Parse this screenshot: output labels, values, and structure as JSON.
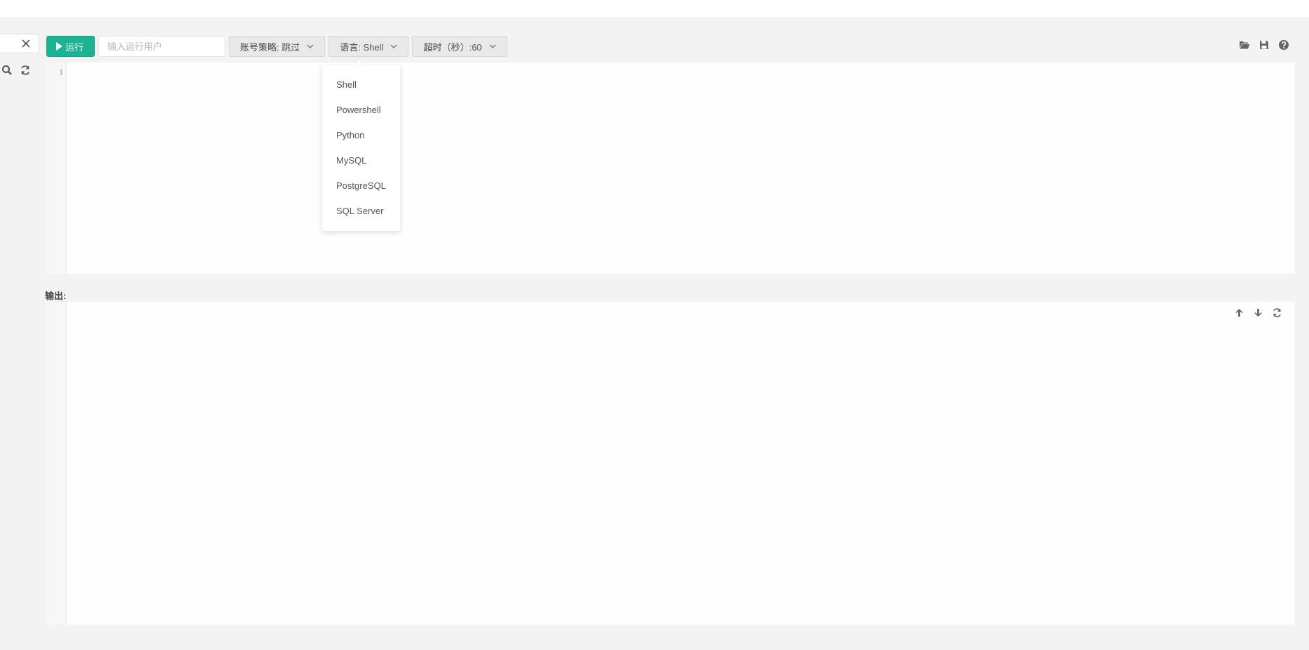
{
  "toolbar": {
    "run_label": "运行",
    "user_placeholder": "输入运行用户",
    "account_policy": {
      "key": "账号策略:",
      "value": "跳过"
    },
    "language": {
      "key": "语言:",
      "value": "Shell"
    },
    "timeout": {
      "key": "超时（秒）:",
      "value": "60"
    }
  },
  "editor": {
    "line_numbers": [
      "1"
    ]
  },
  "output": {
    "label": "输出:"
  },
  "language_menu": {
    "items": [
      "Shell",
      "Powershell",
      "Python",
      "MySQL",
      "PostgreSQL",
      "SQL Server"
    ]
  },
  "colors": {
    "primary": "#1ab394",
    "background": "#f3f3f3"
  },
  "icons": {
    "left": [
      "close-icon",
      "search-icon",
      "refresh-icon"
    ],
    "right": [
      "folder-open-icon",
      "save-icon",
      "help-icon"
    ],
    "output": [
      "arrow-up-icon",
      "arrow-down-icon",
      "refresh-icon"
    ]
  }
}
